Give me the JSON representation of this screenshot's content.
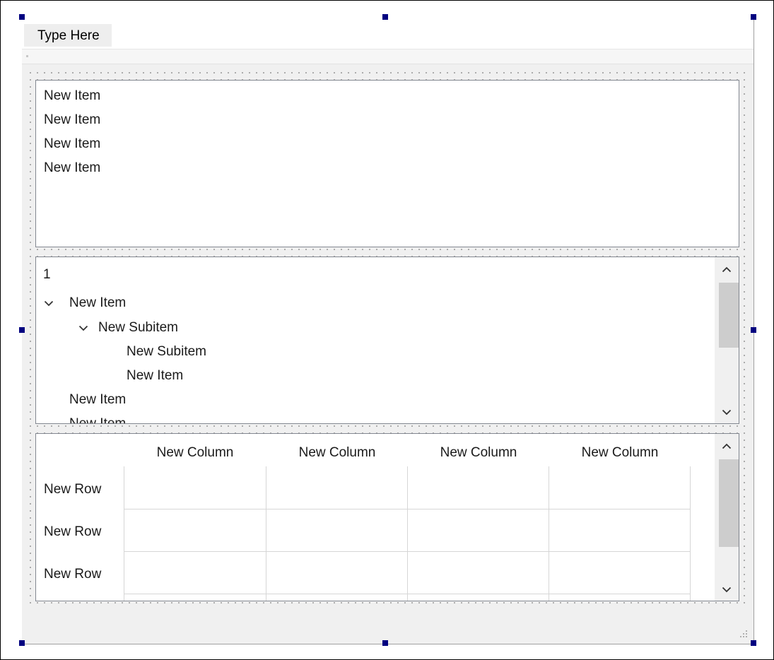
{
  "menubar": {
    "menu_item": "Type Here"
  },
  "list_widget": {
    "items": [
      "New Item",
      "New Item",
      "New Item",
      "New Item"
    ]
  },
  "tree_widget": {
    "header": "1",
    "rows": [
      {
        "label": "New Item",
        "depth": 0,
        "expanded": true
      },
      {
        "label": "New Subitem",
        "depth": 1,
        "expanded": true
      },
      {
        "label": "New Subitem",
        "depth": 2,
        "expanded": null
      },
      {
        "label": "New Item",
        "depth": 2,
        "expanded": null
      },
      {
        "label": "New Item",
        "depth": 0,
        "expanded": null
      },
      {
        "label": "New Item",
        "depth": 0,
        "expanded": null
      }
    ]
  },
  "table_widget": {
    "columns": [
      "New Column",
      "New Column",
      "New Column",
      "New Column"
    ],
    "rows": [
      "New Row",
      "New Row",
      "New Row"
    ]
  },
  "icons": {
    "expand_arrow": "chevron-down-icon",
    "scroll_up": "chevron-up-icon",
    "scroll_down": "chevron-down-icon",
    "resize_grip": "size-grip-icon"
  },
  "colors": {
    "selection_handle": "#000080",
    "form_background": "#f0f0f0",
    "widget_border": "#828790"
  }
}
